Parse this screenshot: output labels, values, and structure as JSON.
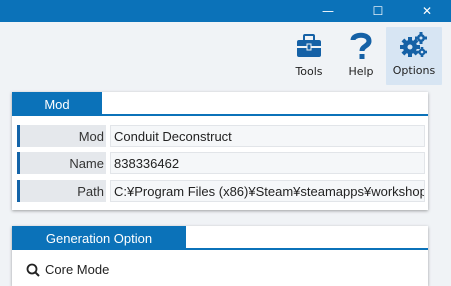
{
  "window": {
    "minimize_glyph": "—",
    "maximize_glyph": "☐",
    "close_glyph": "✕"
  },
  "ribbon": {
    "tools_label": "Tools",
    "help_label": "Help",
    "options_label": "Options",
    "tools_icon": "toolbox-icon",
    "help_icon": "question-mark-icon",
    "options_icon": "gears-icon"
  },
  "mod_group": {
    "title": "Mod",
    "rows": [
      {
        "key": "Mod",
        "value": "Conduit Deconstruct"
      },
      {
        "key": "Name",
        "value": "838336462"
      },
      {
        "key": "Path",
        "value": "C:¥Program Files (x86)¥Steam¥steamapps¥workshop"
      }
    ]
  },
  "generation_group": {
    "title": "Generation Option",
    "core_mode_label": "Core Mode"
  },
  "colors": {
    "accent": "#0b72b9",
    "background": "#f0f3f6",
    "selected_ribbon": "#d7e5f3"
  }
}
